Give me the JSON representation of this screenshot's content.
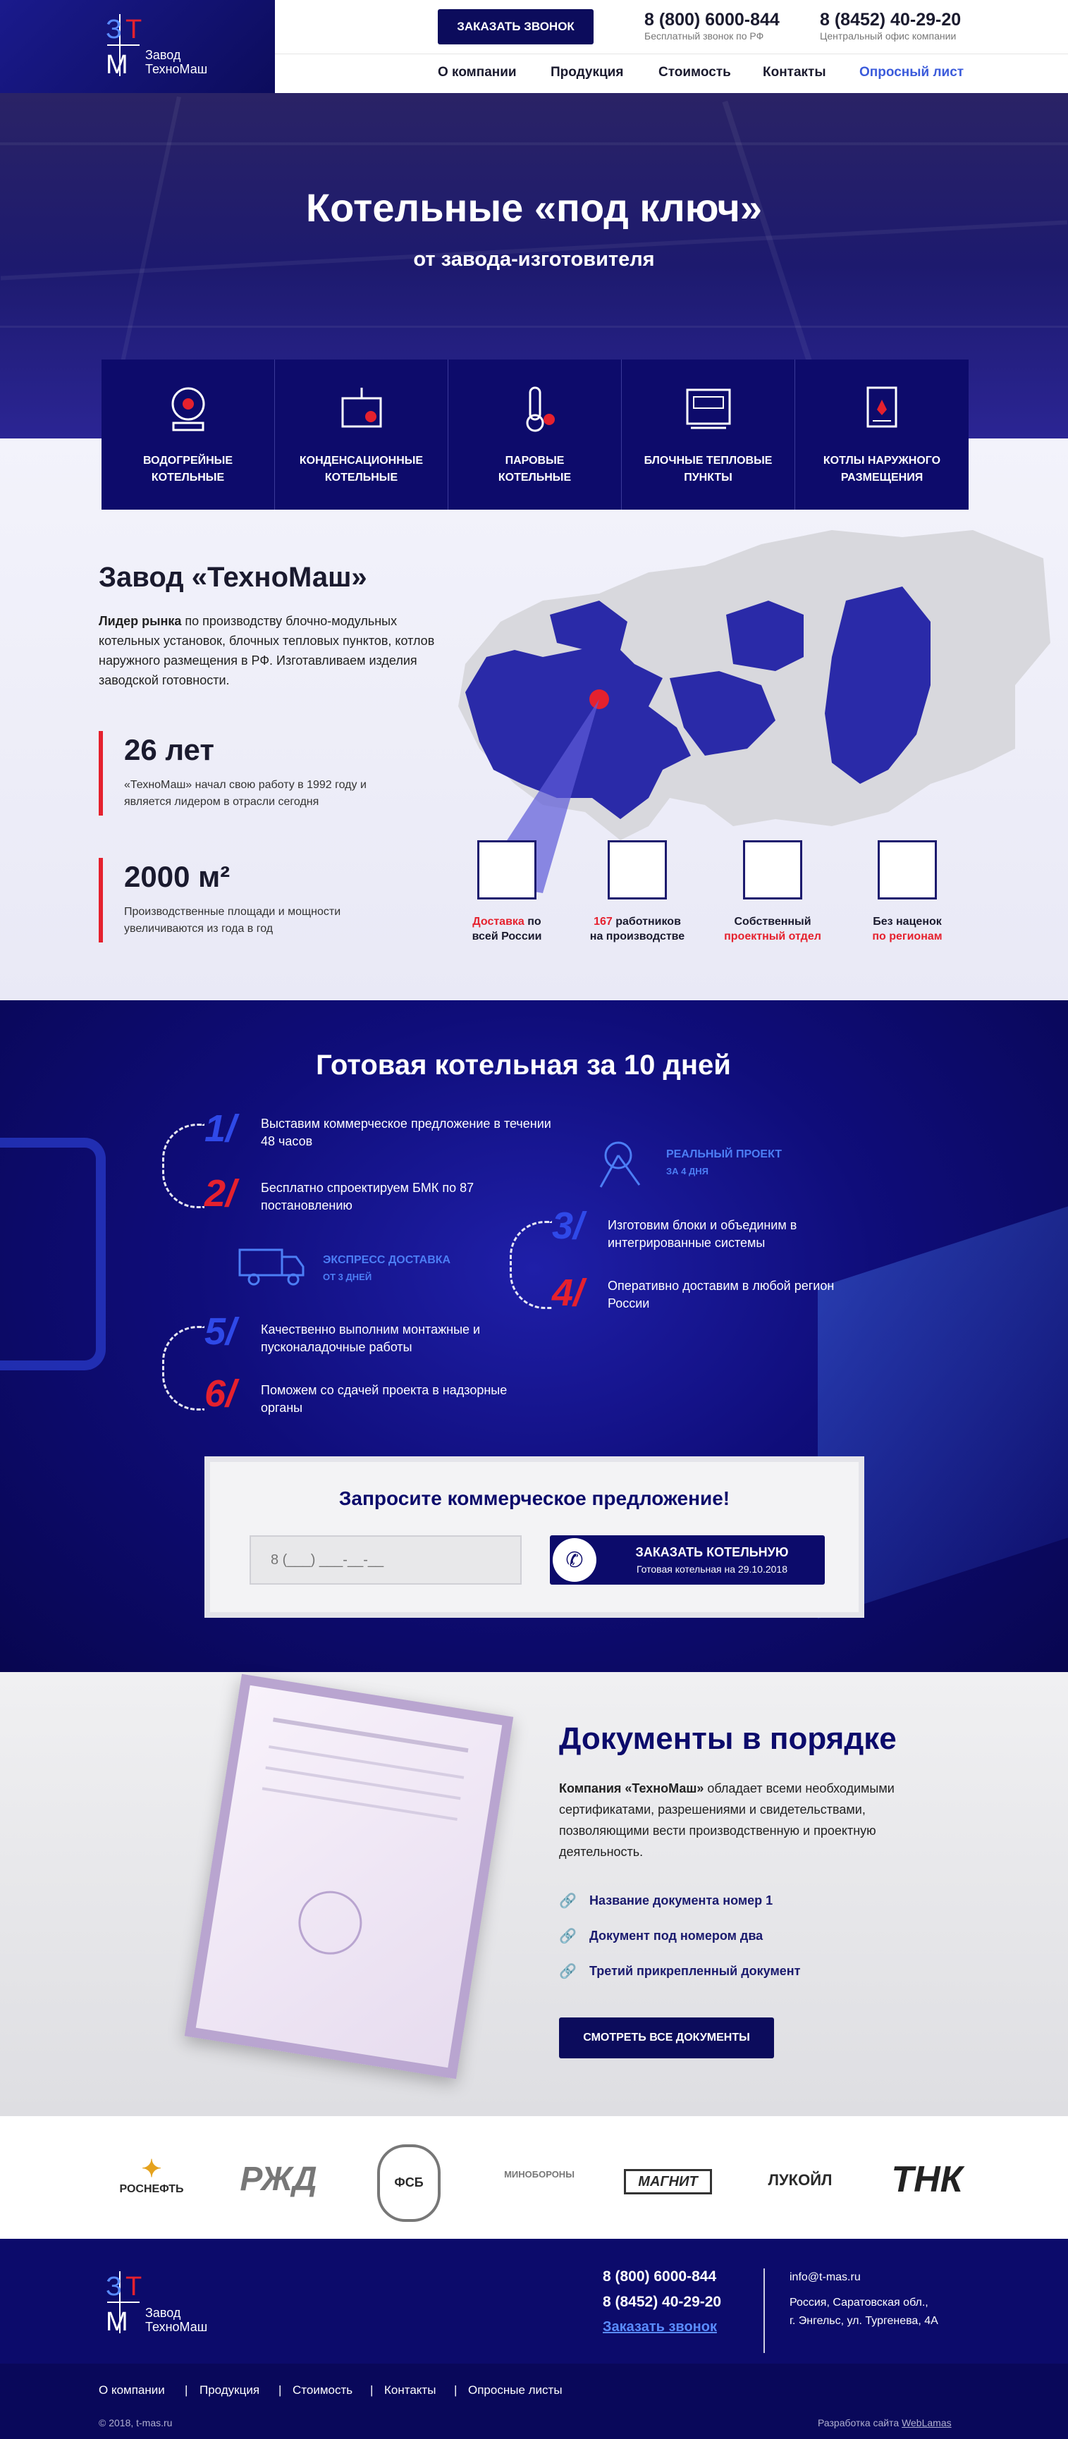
{
  "brand": {
    "letter1": "З",
    "letter2": "Т",
    "letter3": "М",
    "name1": "Завод",
    "name2": "ТехноМаш"
  },
  "header": {
    "call_button": "ЗАКАЗАТЬ ЗВОНОК",
    "phone1": "8 (800) 6000-844",
    "phone1_note": "Бесплатный звонок по РФ",
    "phone2": "8 (8452) 40-29-20",
    "phone2_note": "Центральный офис компании",
    "nav": [
      "О компании",
      "Продукция",
      "Стоимость",
      "Контакты",
      "Опросный лист"
    ]
  },
  "hero": {
    "title": "Котельные «под ключ»",
    "subtitle": "от завода-изготовителя"
  },
  "categories": [
    {
      "line1": "ВОДОГРЕЙНЫЕ",
      "line2": "КОТЕЛЬНЫЕ"
    },
    {
      "line1": "КОНДЕНСАЦИОННЫЕ",
      "line2": "КОТЕЛЬНЫЕ"
    },
    {
      "line1": "ПАРОВЫЕ",
      "line2": "КОТЕЛЬНЫЕ"
    },
    {
      "line1": "БЛОЧНЫЕ ТЕПЛОВЫЕ",
      "line2": "ПУНКТЫ"
    },
    {
      "line1": "КОТЛЫ НАРУЖНОГО",
      "line2": "РАЗМЕЩЕНИЯ"
    }
  ],
  "factory": {
    "title": "Завод «ТехноМаш»",
    "lead_bold": "Лидер рынка",
    "lead_rest": " по производству блочно-модульных котельных установок, блочных тепловых пунктов, котлов наружного размещения в РФ. Изготавливаем изделия заводской готовности.",
    "stat1_value": "26 лет",
    "stat1_text": "«ТехноМаш» начал свою работу в 1992 году и является лидером в отрасли сегодня",
    "stat2_value": "2000 м²",
    "stat2_text": "Производственные площади и мощности увеличиваются из года в год",
    "features": [
      {
        "a": "Доставка",
        "b": " по",
        "c": "всей России"
      },
      {
        "a": "167",
        "b": " работников",
        "c": "на производстве"
      },
      {
        "a": "Собственный",
        "b": "",
        "c": "проектный отдел"
      },
      {
        "a": "Без наценок",
        "b": "",
        "c": "по регионам"
      }
    ]
  },
  "steps": {
    "title": "Готовая котельная за 10 дней",
    "items": [
      {
        "num": "1/",
        "text": "Выставим коммерческое предложение в течении 48 часов"
      },
      {
        "num": "2/",
        "text": "Бесплатно спроектируем БМК по 87 постановлению"
      },
      {
        "num": "3/",
        "text": "Изготовим блоки и объединим в интегрированные системы"
      },
      {
        "num": "4/",
        "text": "Оперативно доставим в любой регион России"
      },
      {
        "num": "5/",
        "text": "Качественно выполним монтажные и пусконаладочные работы"
      },
      {
        "num": "6/",
        "text": "Поможем со сдачей проекта в надзорные органы"
      }
    ],
    "badge1_title": "РЕАЛЬНЫЙ ПРОЕКТ",
    "badge1_sub": "ЗА 4 ДНЯ",
    "badge2_title": "ЭКСПРЕСС ДОСТАВКА",
    "badge2_sub": "ОТ 3 ДНЕЙ"
  },
  "form": {
    "title": "Запросите коммерческое предложение!",
    "placeholder": "8 (___) ___-__-__",
    "button": "ЗАКАЗАТЬ КОТЕЛЬНУЮ",
    "button_sub": "Готовая котельная на 29.10.2018"
  },
  "docs": {
    "title": "Документы в порядке",
    "text_bold": "Компания «ТехноМаш»",
    "text_rest": " обладает всеми необходимыми сертификатами, разрешениями и свидетельствами, позволяющими вести производственную и проектную деятельность.",
    "links": [
      "Название документа номер 1",
      "Документ под номером два",
      "Третий прикрепленный документ"
    ],
    "button": "СМОТРЕТЬ ВСЕ ДОКУМЕНТЫ"
  },
  "clients": [
    "РОСНЕФТЬ",
    "РЖД",
    "ФСБ",
    "МИНОБОРОНЫ",
    "МАГНИТ",
    "ЛУКОЙЛ",
    "ТНК"
  ],
  "footer": {
    "phone1": "8 (800) 6000-844",
    "phone2": "8 (8452) 40-29-20",
    "call": "Заказать звонок",
    "email": "info@t-mas.ru",
    "addr1": "Россия, Саратовская обл.,",
    "addr2": "г. Энгельс, ул. Тургенева, 4А",
    "nav": [
      "О компании",
      "Продукция",
      "Стоимость",
      "Контакты",
      "Опросные листы"
    ],
    "copyright": "© 2018, t-mas.ru",
    "dev": "Разработка сайта ",
    "dev_link": "WebLamas"
  },
  "colors": {
    "navy": "#0c0b6b",
    "red": "#e5212e",
    "accent": "#4c7ef5"
  }
}
